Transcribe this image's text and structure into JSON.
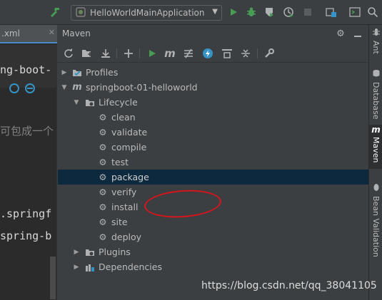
{
  "toolbar": {
    "run_config_label": "HelloWorldMainApplication",
    "icons": [
      "hammer-icon",
      "spring-boot-icon",
      "run-icon",
      "debug-icon",
      "coverage-icon",
      "profiler-icon",
      "stop-icon",
      "project-structure-icon",
      "terminal-icon",
      "search-icon"
    ]
  },
  "editor": {
    "tab_label": ".xml",
    "lines": [
      "ng-boot-",
      ".springf",
      "spring-b"
    ],
    "chinese_text": "可包成一个"
  },
  "maven": {
    "title": "Maven",
    "tree": {
      "profiles": "Profiles",
      "project": "springboot-01-helloworld",
      "lifecycle": "Lifecycle",
      "goals": [
        "clean",
        "validate",
        "compile",
        "test",
        "package",
        "verify",
        "install",
        "site",
        "deploy"
      ],
      "selected_goal": "package",
      "plugins": "Plugins",
      "dependencies": "Dependencies"
    }
  },
  "right_strip": {
    "tabs": [
      "Ant",
      "Database",
      "Maven",
      "Bean Validation"
    ],
    "active": "Maven"
  },
  "watermark": "https://blog.csdn.net/qq_38041105",
  "colors": {
    "background": "#3c3f41",
    "editor_background": "#2b2b2b",
    "selection": "#0d293e",
    "run_green": "#499c54",
    "annotation_red": "#d4161c",
    "accent_blue": "#4a88c7"
  }
}
